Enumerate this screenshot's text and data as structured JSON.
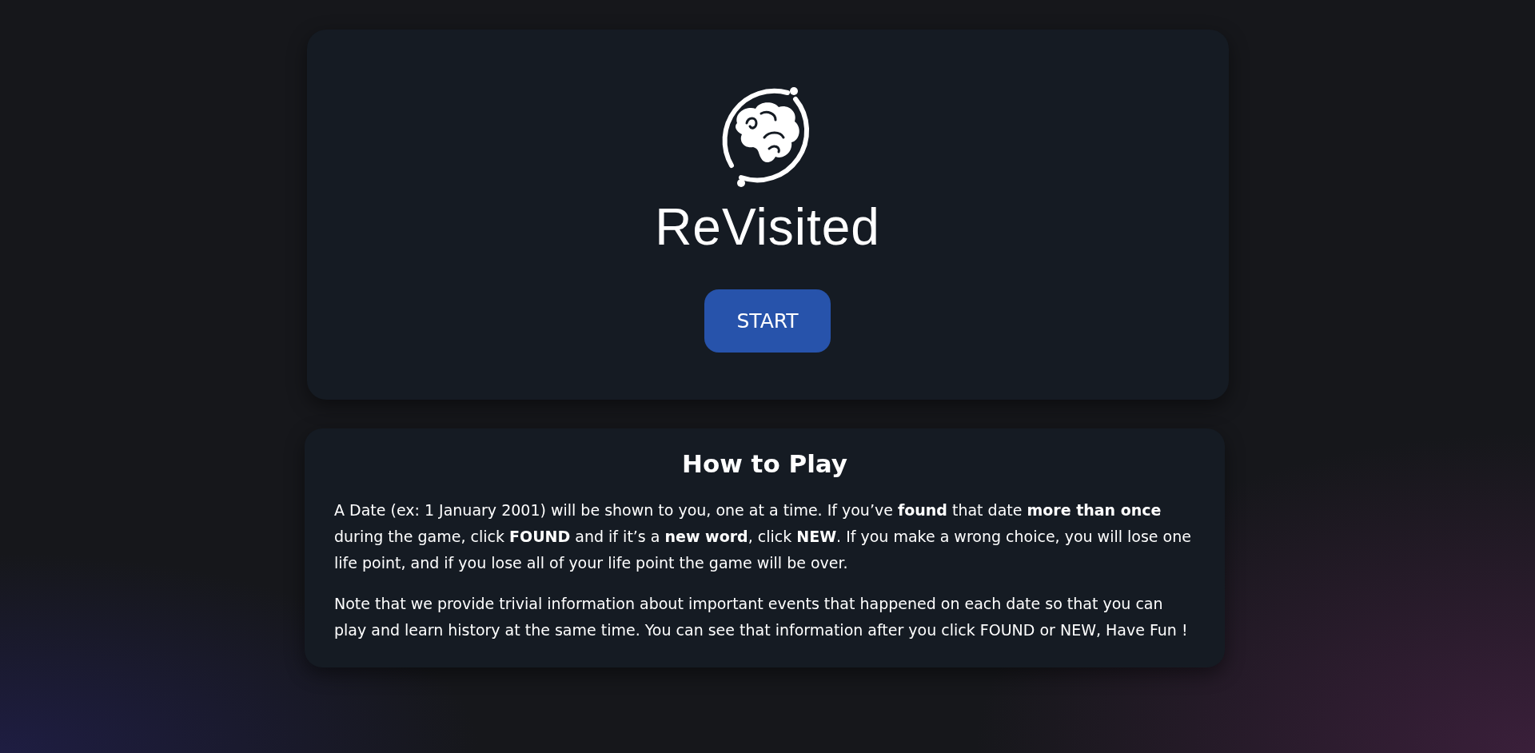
{
  "hero": {
    "title": "ReVisited",
    "start_button": "START"
  },
  "how_to_play": {
    "heading": "How to Play",
    "paragraphs": [
      "A Date (ex: 1 January 2001) will be shown to you, one at a time. If you’ve **found** that date **more than once** during the game, click **FOUND** and if it’s a **new word**, click **NEW**. If you make a wrong choice, you will lose one life point, and if you lose all of your life point the game will be over.",
      "Note that we provide trivial information about important events that happened on each date so that you can play and learn history at the same time. You can see that information after you click FOUND or NEW, Have Fun !"
    ]
  }
}
